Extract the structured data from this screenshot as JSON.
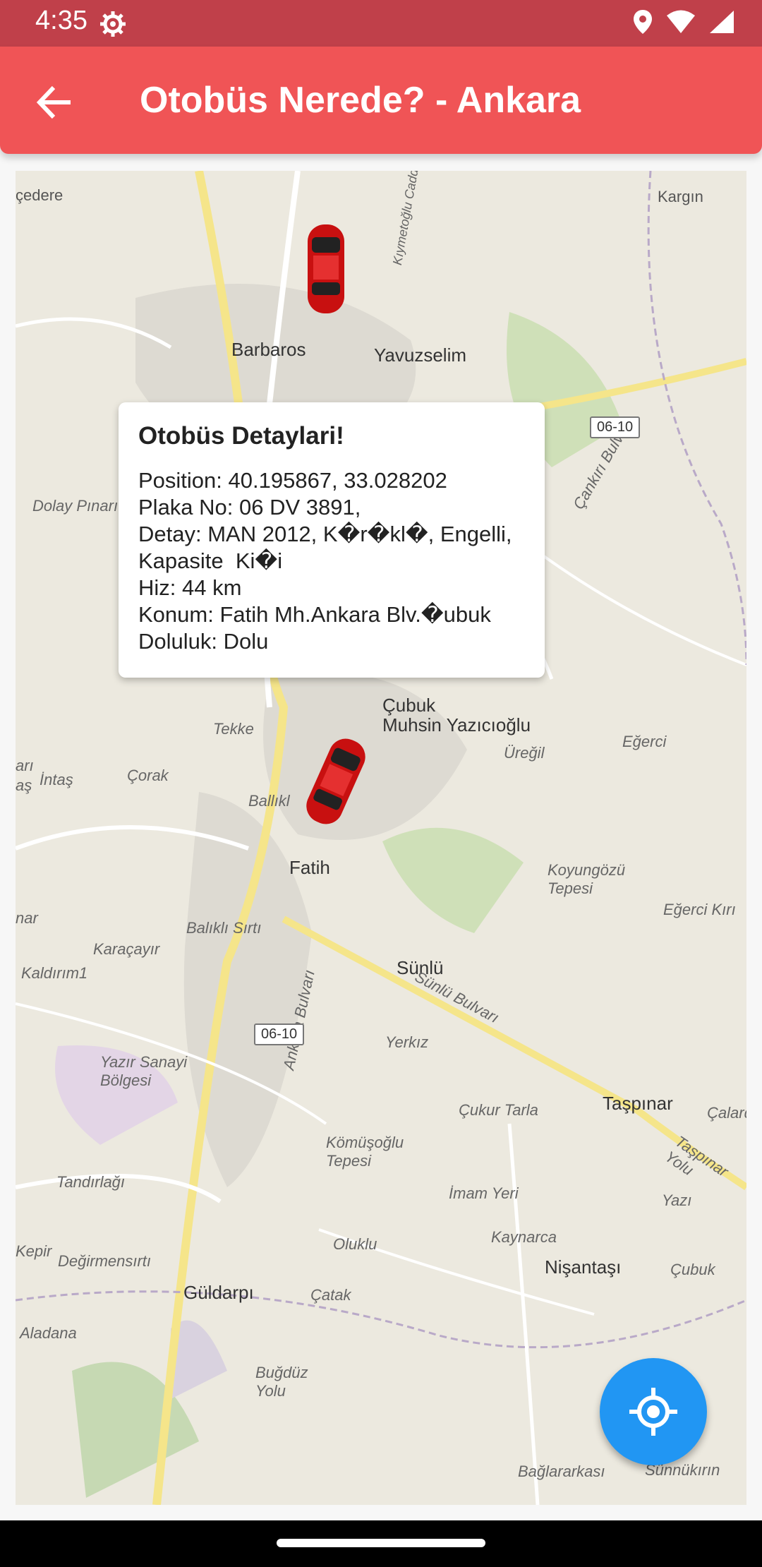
{
  "status": {
    "time": "4:35",
    "icons": [
      "settings-gear-icon",
      "location-pin-icon",
      "wifi-icon",
      "signal-icon"
    ]
  },
  "app_bar": {
    "title": "Otobüs Nerede? - Ankara",
    "back_icon": "arrow-left-icon",
    "color": "#f05456"
  },
  "map": {
    "labels": [
      "Barbaros",
      "Yavuzselim",
      "Kargın",
      "Dolay Pınarı",
      "Çubuk",
      "Muhsin Yazıcıoğlu",
      "Tekke",
      "Fatih",
      "Sünlü",
      "Taşpınar",
      "Güldarpı",
      "Yazır Sanayi Bölgesi",
      "Koyungözü Tepesi",
      "Eğerci",
      "Üreğil",
      "Çorak",
      "Karaçayır",
      "Kaldırım1",
      "Tandırlağı",
      "Değirmensırtı",
      "Kömüşoğlu Tepesi",
      "İmam Yeri",
      "Kaynarca",
      "Nişantaşı",
      "Oluklu",
      "Çatak",
      "Buğdüz Yolu",
      "Aladana",
      "Bağlararkası",
      "Sünnükırın",
      "Yerkız",
      "Çukur Tarla",
      "Eğerci Kırı",
      "Balıklı Sırtı",
      "Yazı",
      "Çalardı",
      "Kepir",
      "İntaş",
      "Çubuk",
      "çedere",
      "Ankara Bulvarı",
      "Sünlü Bulvarı",
      "Çankırı Bulvarı",
      "Kıymetoğlu Cadde",
      "Taşpınar Yolu",
      "Ballıkl",
      "nar",
      "arı",
      "aş"
    ],
    "road_badges": [
      "06-10",
      "06-10"
    ]
  },
  "popup": {
    "title": "Otobüs Detaylari!",
    "position": "Position: 40.195867, 33.028202",
    "plate": "Plaka No: 06 DV 3891,",
    "detail": "Detay: MAN 2012, K�r�kl�, Engelli,",
    "capacity": "Kapasite  Ki�i",
    "speed": "Hiz: 44 km",
    "location": "Konum: Fatih Mh.Ankara Blv.�ubuk",
    "occupancy": "Doluluk: Dolu"
  },
  "fab": {
    "icon": "my-location-icon",
    "color": "#2196f3"
  }
}
